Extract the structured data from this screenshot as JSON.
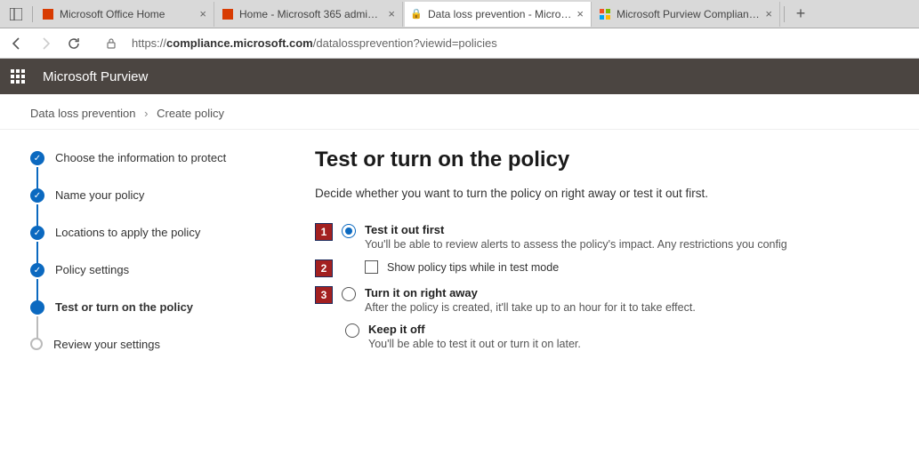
{
  "browser": {
    "tabs": [
      {
        "label": "Microsoft Office Home",
        "favicon_color": "#d83b01",
        "active": false
      },
      {
        "label": "Home - Microsoft 365 admin cen",
        "favicon_color": "#d83b01",
        "active": false
      },
      {
        "label": "Data loss prevention - Microsoft",
        "favicon_color": "#0b69c0",
        "active": true
      },
      {
        "label": "Microsoft Purview Compliance M",
        "favicon_color": "multi",
        "active": false
      }
    ],
    "url_host": "compliance.microsoft.com",
    "url_path": "/datalossprevention?viewid=policies"
  },
  "brand": "Microsoft Purview",
  "breadcrumb": {
    "root": "Data loss prevention",
    "leaf": "Create policy"
  },
  "wizard_steps": [
    {
      "label": "Choose the information to protect",
      "state": "done"
    },
    {
      "label": "Name your policy",
      "state": "done"
    },
    {
      "label": "Locations to apply the policy",
      "state": "done"
    },
    {
      "label": "Policy settings",
      "state": "done"
    },
    {
      "label": "Test or turn on the policy",
      "state": "current"
    },
    {
      "label": "Review your settings",
      "state": "pending"
    }
  ],
  "page": {
    "heading": "Test or turn on the policy",
    "lead": "Decide whether you want to turn the policy on right away or test it out first.",
    "options": {
      "test": {
        "title": "Test it out first",
        "desc": "You'll be able to review alerts to assess the policy's impact. Any restrictions you config",
        "sub_checkbox": "Show policy tips while in test mode",
        "selected": true
      },
      "on": {
        "title": "Turn it on right away",
        "desc": "After the policy is created, it'll take up to an hour for it to take effect."
      },
      "off": {
        "title": "Keep it off",
        "desc": "You'll be able to test it out or turn it on later."
      }
    }
  },
  "callouts": {
    "c1": "1",
    "c2": "2",
    "c3": "3"
  }
}
